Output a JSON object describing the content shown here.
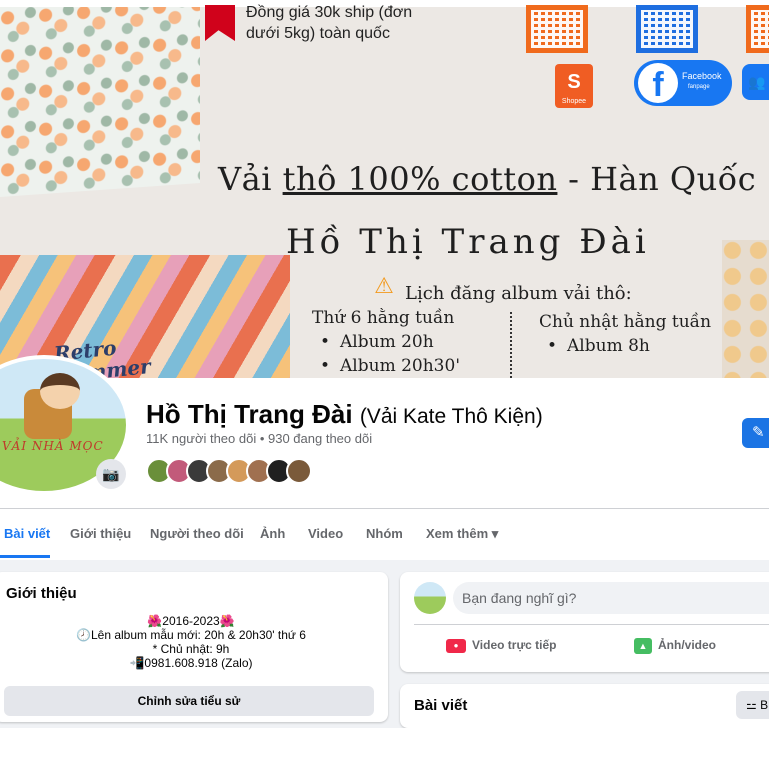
{
  "cover": {
    "promo_line1": "Đồng giá 30k ship (đơn",
    "promo_line2": "dưới 5kg) toàn quốc",
    "shopee_label": "S",
    "shopee_caption": "Shopee",
    "fanpage_label1": "Facebook",
    "fanpage_label2": "fanpage",
    "fb_letter": "f",
    "group_glyph": "👥",
    "title_prefix": "Vải ",
    "title_underlined": "thô 100% cotton",
    "title_suffix": " - Hàn Quốc",
    "shop_name": "Hồ Thị Trang Đài",
    "schedule_title": "Lịch đăng album vải thô:",
    "schedule": {
      "friday": {
        "heading": "Thứ 6 hằng tuần",
        "items": [
          "Album 20h",
          "Album 20h30'"
        ]
      },
      "sunday": {
        "heading": "Chủ nhật hằng tuần",
        "items": [
          "Album 8h"
        ]
      }
    },
    "fabric_label": "Retro\nSummer"
  },
  "profile": {
    "name": "Hồ Thị Trang Đài",
    "alt_name": "(Vải Kate Thô Kiện)",
    "followers": "11K người theo dõi • 930 đang theo dõi",
    "avatar_text": "VẢI NHÀ MỌC",
    "edit_glyph": "✎",
    "camera_glyph": "📷",
    "friend_colors": [
      "#6a8f3a",
      "#c25a7a",
      "#3a3a3a",
      "#8b6b4a",
      "#d49a5a",
      "#a07050",
      "#202020",
      "#7a5a3a"
    ]
  },
  "tabs": [
    {
      "label": "Bài viết",
      "active": true
    },
    {
      "label": "Giới thiệu"
    },
    {
      "label": "Người theo dõi"
    },
    {
      "label": "Ảnh"
    },
    {
      "label": "Video"
    },
    {
      "label": "Nhóm"
    },
    {
      "label": "Xem thêm ▾"
    }
  ],
  "intro": {
    "title": "Giới thiệu",
    "bio": [
      "🌺2016-2023🌺",
      "🕗Lên album mẫu mới: 20h & 20h30' thứ 6",
      "* Chủ nhật: 9h",
      "📲0981.608.918 (Zalo)"
    ],
    "edit_bio_label": "Chỉnh sửa tiểu sử"
  },
  "composer": {
    "placeholder": "Bạn đang nghĩ gì?",
    "live_label": "Video trực tiếp",
    "photo_label": "Ảnh/video"
  },
  "posts": {
    "title": "Bài viết",
    "filter_label": "⚍ B"
  },
  "colors": {
    "accent": "#1877f2",
    "live": "#f02849",
    "photo": "#45bd62"
  }
}
